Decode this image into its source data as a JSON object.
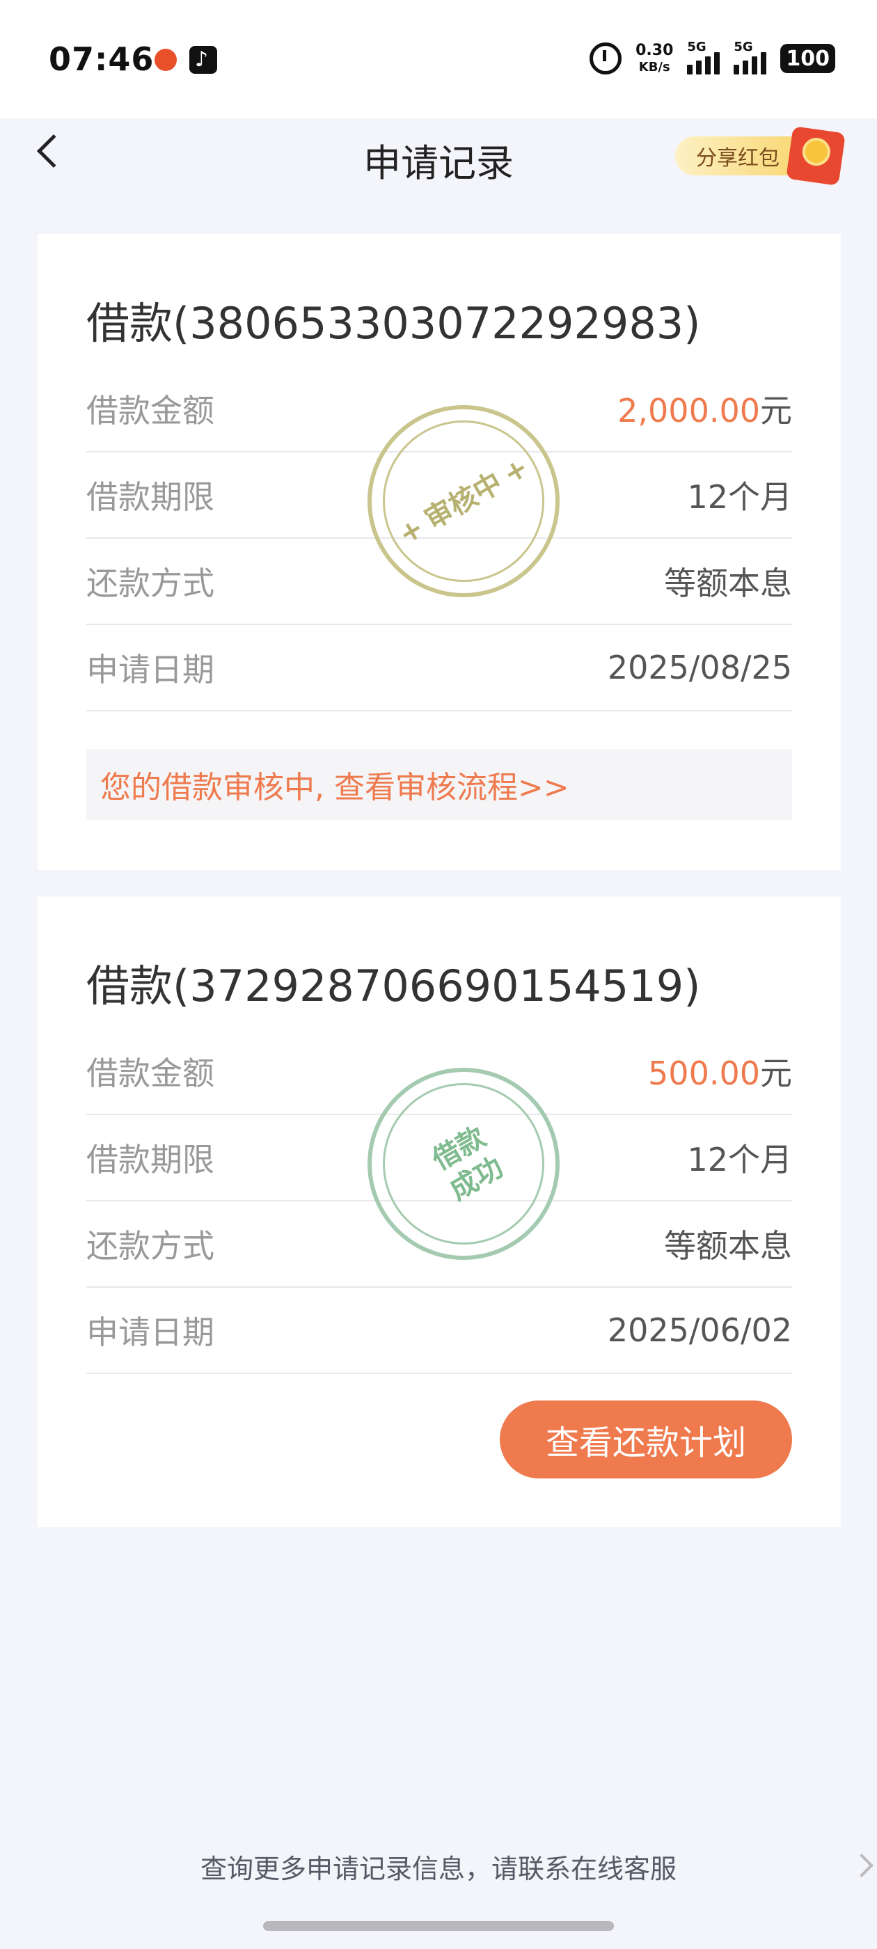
{
  "status_bar": {
    "time": "07:46",
    "net_speed_value": "0.30",
    "net_speed_unit": "KB/s",
    "signal_1_label": "5G",
    "signal_2_label": "5G",
    "battery": "100"
  },
  "nav": {
    "title": "申请记录",
    "share_label": "分享红包"
  },
  "records": [
    {
      "title": "借款(3806533030722929​83)",
      "rows": [
        {
          "label": "借款金额",
          "amount": "2,000.00",
          "unit": "元"
        },
        {
          "label": "借款期限",
          "value": "12个月"
        },
        {
          "label": "还款方式",
          "value": "等额本息"
        },
        {
          "label": "申请日期",
          "value": "2025/08/25"
        }
      ],
      "stamp": "审核中",
      "notice": "您的借款审核中, 查看审核流程>>"
    },
    {
      "title": "借款(372928706690154519)",
      "rows": [
        {
          "label": "借款金额",
          "amount": "500.00",
          "unit": "元"
        },
        {
          "label": "借款期限",
          "value": "12个月"
        },
        {
          "label": "还款方式",
          "value": "等额本息"
        },
        {
          "label": "申请日期",
          "value": "2025/06/02"
        }
      ],
      "stamp_line1": "借款",
      "stamp_line2": "成功",
      "button": "查看还款计划"
    }
  ],
  "footer": {
    "text": "查询更多申请记录信息，请联系在线客服"
  },
  "colors": {
    "accent": "#ef7a4e",
    "stamp_review": "#c9c58d",
    "stamp_success": "#a4cbb0"
  }
}
